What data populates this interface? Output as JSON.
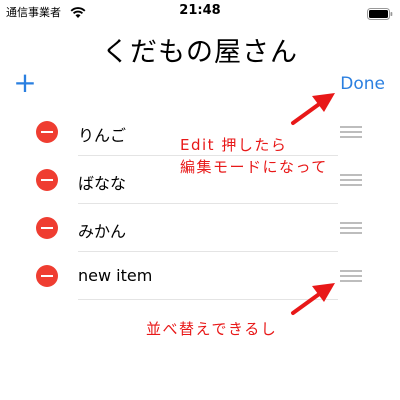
{
  "status_bar": {
    "carrier": "通信事業者",
    "time": "21:48",
    "icons": [
      "wifi-icon",
      "battery-icon"
    ]
  },
  "nav": {
    "title": "くだもの屋さん",
    "add_label": "+",
    "done_label": "Done",
    "accent_color": "#2a7fe0"
  },
  "list": {
    "items": [
      {
        "label": "りんご"
      },
      {
        "label": "ばなな"
      },
      {
        "label": "みかん"
      },
      {
        "label": "new item"
      }
    ],
    "delete_color": "#ef3d31"
  },
  "annotations": {
    "edit_note": "Edit 押したら\n編集モードになって",
    "reorder_note": "並べ替えできるし",
    "color": "#e81818"
  }
}
